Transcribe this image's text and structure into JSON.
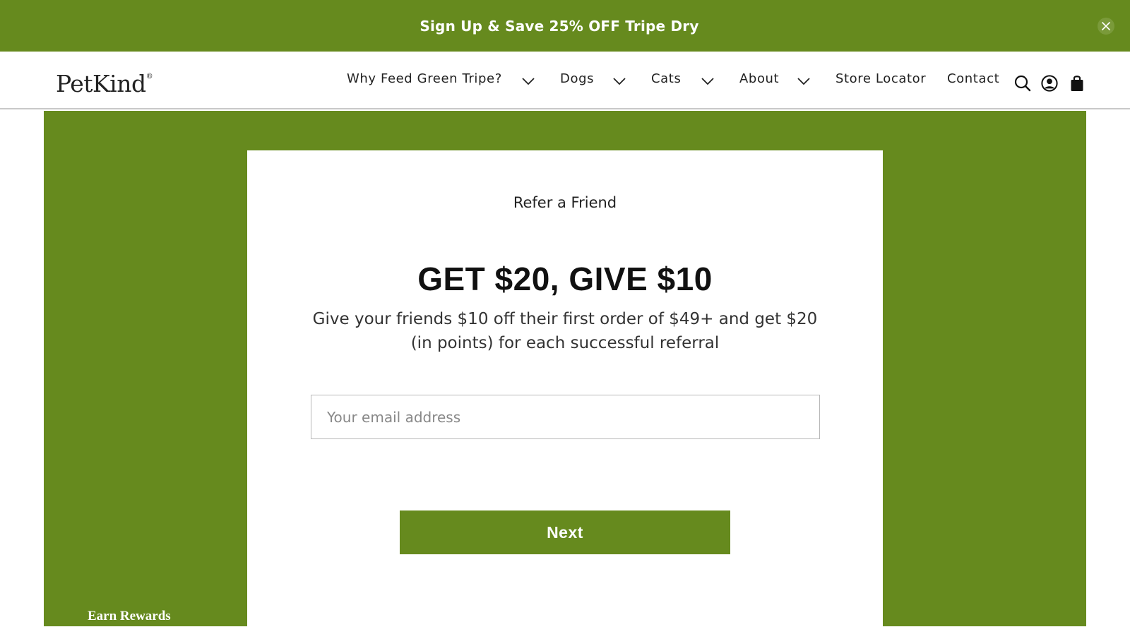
{
  "announcement": {
    "text": "Sign Up & Save 25% OFF Tripe Dry",
    "close_icon": "close-icon"
  },
  "header": {
    "logo": "PetKind",
    "logo_mark": "®",
    "nav": {
      "why": "Why Feed Green Tripe?",
      "dogs": "Dogs",
      "cats": "Cats",
      "about": "About",
      "store_locator": "Store Locator",
      "contact": "Contact"
    },
    "icons": [
      "search-icon",
      "account-icon",
      "cart-icon"
    ]
  },
  "referral": {
    "subtitle": "Refer a Friend",
    "headline": "GET $20, GIVE $10",
    "description": "Give your friends $10 off their first order of $49+ and get $20 (in points) for each successful referral",
    "email_placeholder": "Your email address",
    "email_value": "",
    "next_label": "Next"
  },
  "rewards": {
    "label": "Earn Rewards"
  },
  "colors": {
    "brand_green": "#668a1e",
    "text_dark": "#222222",
    "white": "#ffffff"
  }
}
